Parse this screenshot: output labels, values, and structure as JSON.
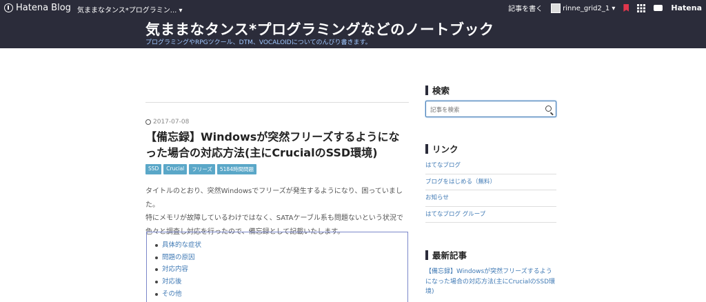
{
  "topbar": {
    "brand": "Hatena Blog",
    "blog_selector": "気ままなタンス*プログラミン... ▾",
    "write_post": "記事を書く",
    "username": "rinne_grid2_1 ▾",
    "hatena": "Hatena"
  },
  "header": {
    "title": "気ままなタンス*プログラミングなどのノートブック",
    "description": "プログラミングやRPGツクール、DTM、VOCALOIDについてのんびり書きます。"
  },
  "entry": {
    "date": "2017-07-08",
    "title": "【備忘録】Windowsが突然フリーズするようになった場合の対応方法(主にCrucialのSSD環境)",
    "tags": [
      "SSD",
      "Crucial",
      "フリーズ",
      "5184時間問題"
    ],
    "body_lines": [
      "タイトルのとおり、突然Windowsでフリーズが発生するようになり、困っていました。",
      "特にメモリが故障しているわけではなく、SATAケーブル系も問題ないという状況で",
      "色々と調査し対応を行ったので、備忘録として記載いたします。"
    ],
    "toc": [
      "具体的な症状",
      "問題の原因",
      "対応内容",
      "対応後",
      "その他"
    ]
  },
  "sidebar": {
    "search_heading": "検索",
    "search_placeholder": "記事を検索",
    "links_heading": "リンク",
    "links": [
      "はてなブログ",
      "ブログをはじめる（無料）",
      "お知らせ",
      "はてなブログ グループ"
    ],
    "recent_heading": "最新記事",
    "recent_post": "【備忘録】Windowsが突然フリーズするようになった場合の対応方法(主にCrucialのSSD環境)"
  }
}
